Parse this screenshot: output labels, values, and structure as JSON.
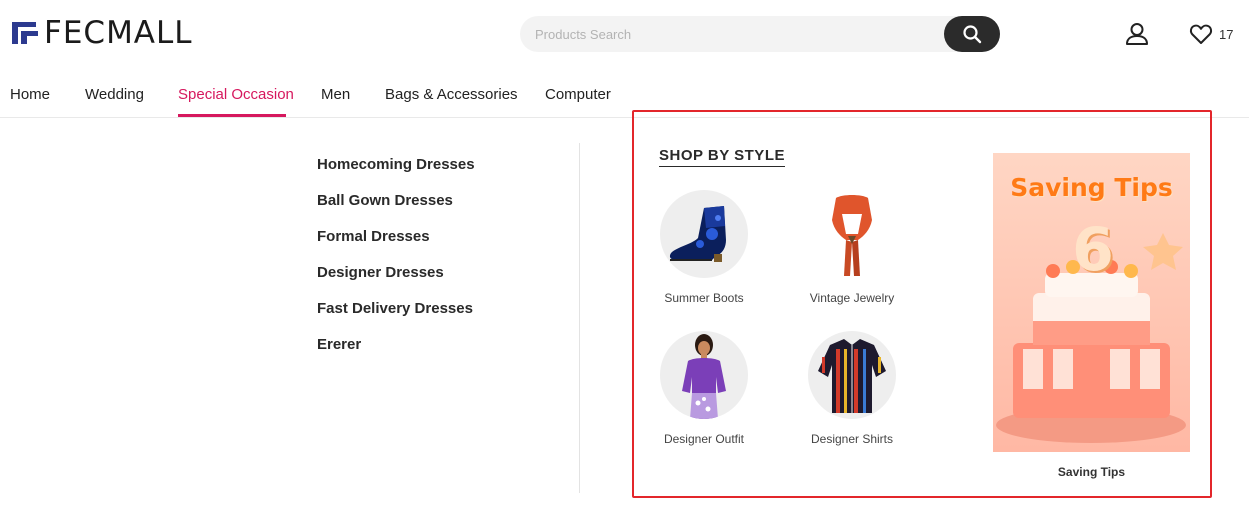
{
  "brand": {
    "name": "FECMALL",
    "accent": "#2c3a8f"
  },
  "search": {
    "placeholder": "Products Search"
  },
  "header": {
    "wishlist_count": "17"
  },
  "nav": {
    "items": [
      {
        "label": "Home"
      },
      {
        "label": "Wedding"
      },
      {
        "label": "Special Occasion",
        "active": true
      },
      {
        "label": "Men"
      },
      {
        "label": "Bags & Accessories"
      },
      {
        "label": "Computer"
      }
    ],
    "active_color": "#d6185e"
  },
  "dropdown": {
    "links": [
      "Homecoming Dresses",
      "Ball Gown Dresses",
      "Formal Dresses",
      "Designer Dresses",
      "Fast Delivery Dresses",
      "Ererer"
    ],
    "shop_by_style": {
      "title": "SHOP BY STYLE",
      "items": [
        {
          "label": "Summer Boots",
          "icon": "boot-image"
        },
        {
          "label": "Vintage Jewelry",
          "icon": "scarf-necklace-image"
        },
        {
          "label": "Designer Outfit",
          "icon": "woman-outfit-image"
        },
        {
          "label": "Designer Shirts",
          "icon": "striped-shirt-image"
        }
      ]
    },
    "promo": {
      "title": "Saving Tips",
      "caption": "Saving Tips",
      "number": "6"
    },
    "highlight_color": "#e3262b"
  }
}
